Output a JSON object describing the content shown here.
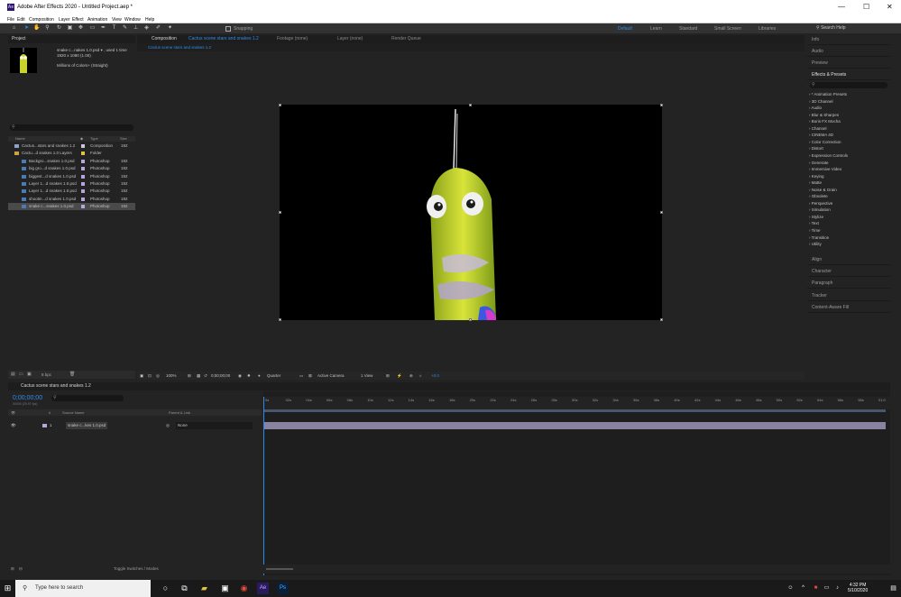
{
  "window": {
    "title": "Adobe After Effects 2020 - Untitled Project.aep *",
    "app_badge": "Ae",
    "minimize": "—",
    "maximize": "☐",
    "close": "✕"
  },
  "menu": [
    "File",
    "Edit",
    "Composition",
    "Layer",
    "Effect",
    "Animation",
    "View",
    "Window",
    "Help"
  ],
  "toolbar": {
    "snapping_label": "Snapping",
    "workspaces": [
      "Default",
      "Learn",
      "Standard",
      "Small Screen",
      "Libraries"
    ],
    "active_workspace": "Default",
    "search_help_placeholder": "Search Help"
  },
  "project": {
    "tab_label": "Project",
    "selected_name": "snake c...nakes 1.0.psd ▾ , used 1 time",
    "selected_dims": "1920 x 1080 (1.00)",
    "selected_colors": "Millions of Colors+ (Straight)",
    "columns": [
      "Name",
      "Type",
      "Size"
    ],
    "items": [
      {
        "name": "Cactus...stars and snakes 1.2",
        "type": "Composition",
        "size": "192",
        "indent": 0,
        "icon": "composition-icon",
        "label_color": "#c9c9d9"
      },
      {
        "name": "Cactu...d snakes 1.0 Layers",
        "type": "Folder",
        "size": "",
        "indent": 0,
        "icon": "folder-icon",
        "label_color": "#e0c24a"
      },
      {
        "name": "Backgro...snakes 1.0.psd",
        "type": "Photoshop",
        "size": "192",
        "indent": 1,
        "icon": "photoshop-file-icon",
        "label_color": "#b8a6d8"
      },
      {
        "name": "big gro...d snakes 1.0.psd",
        "type": "Photoshop",
        "size": "192",
        "indent": 1,
        "icon": "photoshop-file-icon",
        "label_color": "#b8a6d8"
      },
      {
        "name": "biggest...d snakes 1.0.psd",
        "type": "Photoshop",
        "size": "192",
        "indent": 1,
        "icon": "photoshop-file-icon",
        "label_color": "#b8a6d8"
      },
      {
        "name": "Layer 1...d snakes 1.0.psd",
        "type": "Photoshop",
        "size": "192",
        "indent": 1,
        "icon": "photoshop-file-icon",
        "label_color": "#b8a6d8"
      },
      {
        "name": "Layer 1...d snakes 1.0.psd",
        "type": "Photoshop",
        "size": "192",
        "indent": 1,
        "icon": "photoshop-file-icon",
        "label_color": "#b8a6d8"
      },
      {
        "name": "shootin...d snakes 1.0.psd",
        "type": "Photoshop",
        "size": "192",
        "indent": 1,
        "icon": "photoshop-file-icon",
        "label_color": "#b8a6d8"
      },
      {
        "name": "snake c...snakes 1.0.psd",
        "type": "Photoshop",
        "size": "192",
        "indent": 1,
        "icon": "photoshop-file-icon",
        "label_color": "#b8a6d8",
        "selected": true
      }
    ],
    "footer_bpc": "8 bpc"
  },
  "composition": {
    "tab_prefix": "Composition",
    "tab_name": "Cactus scene stars and snakes 1.2",
    "other_tabs": [
      "Footage (none)",
      "Layer (none)",
      "Render Queue"
    ],
    "breadcrumb": "Cactus scene stars and snakes 1.2",
    "footer": {
      "zoom": "100%",
      "timecode": "0;00;00;00",
      "resolution": "Quarter",
      "camera": "Active Camera",
      "views": "1 View",
      "exposure": "+0.0"
    }
  },
  "effects_panel": {
    "top_tabs": [
      "Info",
      "Audio",
      "Preview"
    ],
    "title": "Effects & Presets",
    "categories": [
      "* Animation Presets",
      "3D Channel",
      "Audio",
      "Blur & Sharpen",
      "Boris FX Mocha",
      "Channel",
      "CINEMA 4D",
      "Color Correction",
      "Distort",
      "Expression Controls",
      "Generate",
      "Immersive Video",
      "Keying",
      "Matte",
      "Noise & Grain",
      "Obsolete",
      "Perspective",
      "Simulation",
      "Stylize",
      "Text",
      "Time",
      "Transition",
      "Utility"
    ],
    "bottom_tabs": [
      "Align",
      "Character",
      "Paragraph",
      "Tracker",
      "Content-Aware Fill"
    ]
  },
  "timeline": {
    "tab_label": "Cactus scene stars and snakes 1.2",
    "timecode": "0;00;00;00",
    "timecode_sub": "00000 (29.97 fps)",
    "columns": [
      "#",
      "Source Name",
      "Parent & Link"
    ],
    "layer": {
      "index": "1",
      "name": "snake c...kes 1.0.psd",
      "parent": "None"
    },
    "ruler": [
      "0s",
      "02s",
      "04s",
      "06s",
      "08s",
      "10s",
      "12s",
      "14s",
      "16s",
      "18s",
      "20s",
      "22s",
      "24s",
      "26s",
      "28s",
      "30s",
      "32s",
      "34s",
      "36s",
      "38s",
      "40s",
      "42s",
      "44s",
      "46s",
      "48s",
      "50s",
      "52s",
      "54s",
      "56s",
      "58s",
      "01:0"
    ],
    "footer_label": "Toggle Switches / Modes"
  },
  "taskbar": {
    "search_placeholder": "Type here to search",
    "time": "4:32 PM",
    "date": "5/10/2020"
  }
}
